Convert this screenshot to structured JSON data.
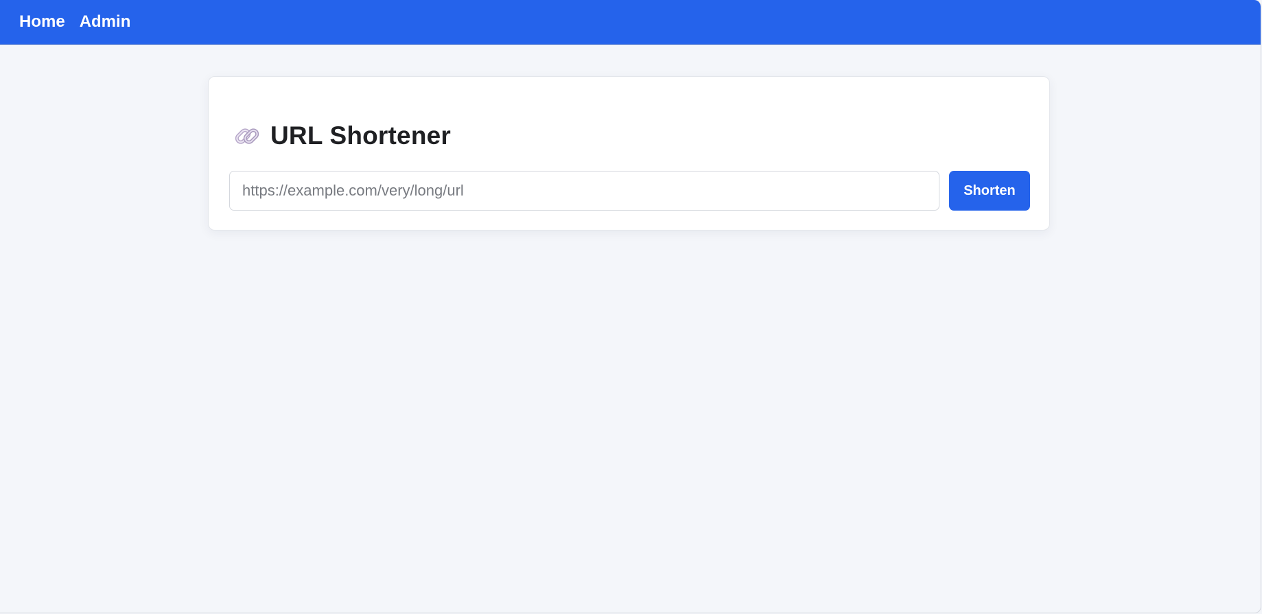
{
  "nav": {
    "home_label": "Home",
    "admin_label": "Admin"
  },
  "card": {
    "icon": "link-icon",
    "title": "URL Shortener",
    "input_placeholder": "https://example.com/very/long/url",
    "input_value": "",
    "button_label": "Shorten"
  },
  "colors": {
    "accent": "#2563eb",
    "background": "#f4f6fa",
    "card": "#ffffff"
  }
}
